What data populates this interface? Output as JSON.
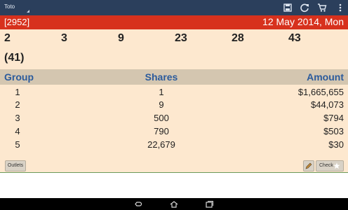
{
  "app": {
    "title": "Toto"
  },
  "draw": {
    "number": "[2952]",
    "date": "12 May 2014, Mon"
  },
  "winning_numbers": [
    "2",
    "3",
    "9",
    "23",
    "28",
    "43"
  ],
  "additional_number": "(41)",
  "table": {
    "headers": {
      "group": "Group",
      "shares": "Shares",
      "amount": "Amount"
    },
    "rows": [
      {
        "group": "1",
        "shares": "1",
        "amount": "$1,665,655"
      },
      {
        "group": "2",
        "shares": "9",
        "amount": "$44,073"
      },
      {
        "group": "3",
        "shares": "500",
        "amount": "$794"
      },
      {
        "group": "4",
        "shares": "790",
        "amount": "$503"
      },
      {
        "group": "5",
        "shares": "22,679",
        "amount": "$30"
      }
    ]
  },
  "buttons": {
    "outlets": "Outlets",
    "check": "Check"
  },
  "icons": {
    "actionbar": [
      "save-icon",
      "refresh-icon",
      "cart-icon",
      "overflow-menu-icon"
    ],
    "navigation": [
      "back-icon",
      "home-icon",
      "recents-icon"
    ]
  },
  "colors": {
    "actionbar": "#2b3f5c",
    "drawbar": "#d7311d",
    "background": "#fde8cf",
    "header_band": "#d4c6b0",
    "header_text": "#2b5b9c"
  }
}
